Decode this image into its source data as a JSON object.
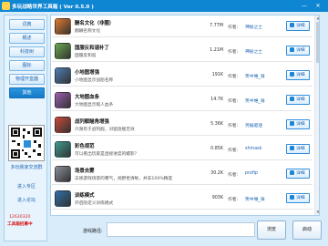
{
  "app": {
    "title": "多玩战略世界工具箱  ( Ver 0.5.0 )"
  },
  "window": {
    "minimize_glyph": "—",
    "close_glyph": "✕"
  },
  "sidebar": {
    "items": [
      {
        "label": "词典",
        "active": false
      },
      {
        "label": "概述",
        "active": false
      },
      {
        "label": "科技树",
        "active": false
      },
      {
        "label": "图标",
        "active": false
      },
      {
        "label": "物理开盒器",
        "active": false
      },
      {
        "label": "其他",
        "active": true
      }
    ],
    "qr_caption": "多玩我家交流群",
    "link1": "进入专区",
    "link2": "进入论坛",
    "phone": "12630320",
    "promo": "工具箱招募中"
  },
  "list": {
    "author_label": "作者:",
    "detail_label": "详细",
    "items": [
      {
        "title": "酬名文化（非圈）",
        "desc": "翻酬名称文化",
        "size": "7.77M",
        "author": "神秘之士",
        "icon_color": "#e07a2e"
      },
      {
        "title": "国服反和谐补丁",
        "desc": "国服反和谐",
        "size": "1.21M",
        "author": "神秘之士",
        "icon_color": "#6aa84f"
      },
      {
        "title": "小地图增强",
        "desc": "小地图显示战船名称",
        "size": "191K",
        "author": "笑中唯_骑",
        "icon_color": "#4e7fb5"
      },
      {
        "title": "大地图血条",
        "desc": "大地图显示敌人血条",
        "size": "14.7K",
        "author": "笑中唯_骑",
        "icon_color": "#9b5fb0"
      },
      {
        "title": "战列舰瞄角增强",
        "desc": "只限有于战列舰，对驱逐舰无效",
        "size": "5.36K",
        "author": "另据驱逐",
        "icon_color": "#c94a3b"
      },
      {
        "title": "彩色视范",
        "desc": "可以看出玩家是直接进度的螺影？",
        "size": "0.85K",
        "author": "shmask",
        "icon_color": "#3f9b8f"
      },
      {
        "title": "场景去雾",
        "desc": "去除游戏场景的雾气，视野更清晰，并非100%精度",
        "size": "30.2K",
        "author": "profip",
        "icon_color": "#8a8f99"
      },
      {
        "title": "训练模式",
        "desc": "开启隐定义训练模式",
        "size": "903K",
        "author": "笑中唯_骑",
        "icon_color": "#2f6fa8"
      }
    ]
  },
  "footer": {
    "path_label": "游戏路径:",
    "path_value": "",
    "browse_label": "浏览",
    "launch_label": "启动"
  }
}
